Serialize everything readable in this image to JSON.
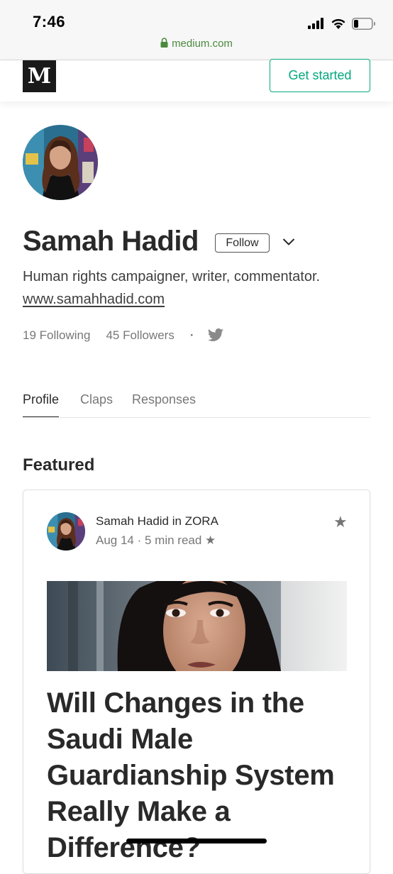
{
  "status_bar": {
    "time": "7:46",
    "url": "medium.com",
    "icons": [
      "signal-icon",
      "wifi-icon",
      "battery-icon"
    ]
  },
  "header": {
    "logo": "M",
    "get_started_label": "Get started"
  },
  "profile": {
    "name": "Samah Hadid",
    "follow_label": "Follow",
    "bio": "Human rights campaigner, writer, commentator.",
    "website": "www.samahhadid.com",
    "following": "19 Following",
    "followers": "45 Followers",
    "separator": "·"
  },
  "tabs": [
    {
      "label": "Profile",
      "active": true
    },
    {
      "label": "Claps",
      "active": false
    },
    {
      "label": "Responses",
      "active": false
    }
  ],
  "featured": {
    "heading": "Featured",
    "article": {
      "author_line": "Samah Hadid in ZORA",
      "meta": "Aug 14 · 5 min read ★",
      "title": "Will Changes in the Saudi Male Guardianship System Really Make a Difference?"
    }
  },
  "colors": {
    "accent_green": "#03a87c",
    "url_green": "#4a8a3e",
    "twitter_gray": "#8a8a8a"
  }
}
